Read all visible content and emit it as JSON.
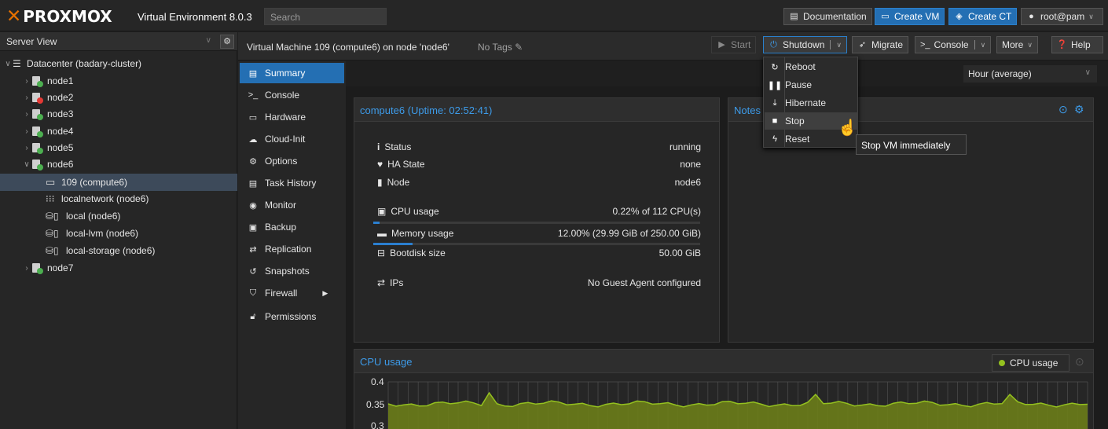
{
  "header": {
    "logo_text": "PROXMOX",
    "product": "Virtual Environment 8.0.3",
    "search_placeholder": "Search",
    "buttons": {
      "documentation": "Documentation",
      "create_vm": "Create VM",
      "create_ct": "Create CT",
      "user": "root@pam"
    }
  },
  "sidebar": {
    "view": "Server View",
    "datacenter": "Datacenter (badary-cluster)",
    "nodes": [
      "node1",
      "node2",
      "node3",
      "node4",
      "node5",
      "node6"
    ],
    "node6_children": [
      "109 (compute6)",
      "localnetwork (node6)",
      "local (node6)",
      "local-lvm (node6)",
      "local-storage (node6)"
    ],
    "last_node": "node7"
  },
  "vm_toolbar": {
    "title": "Virtual Machine 109 (compute6) on node 'node6'",
    "tags": "No Tags",
    "start": "Start",
    "shutdown": "Shutdown",
    "migrate": "Migrate",
    "console": "Console",
    "more": "More",
    "help": "Help"
  },
  "nav": {
    "items": [
      "Summary",
      "Console",
      "Hardware",
      "Cloud-Init",
      "Options",
      "Task History",
      "Monitor",
      "Backup",
      "Replication",
      "Snapshots",
      "Firewall",
      "Permissions"
    ]
  },
  "timeframe": "Hour (average)",
  "status_panel": {
    "title": "compute6 (Uptime: 02:52:41)",
    "rows": [
      {
        "label": "Status",
        "value": "running"
      },
      {
        "label": "HA State",
        "value": "none"
      },
      {
        "label": "Node",
        "value": "node6"
      },
      {
        "label": "CPU usage",
        "value": "0.22% of 112 CPU(s)"
      },
      {
        "label": "Memory usage",
        "value": "12.00% (29.99 GiB of 250.00 GiB)"
      },
      {
        "label": "Bootdisk size",
        "value": "50.00 GiB"
      },
      {
        "label": "IPs",
        "value": "No Guest Agent configured"
      }
    ],
    "cpu_fraction": 0.0022,
    "memory_fraction": 0.12
  },
  "notes_panel": {
    "title": "Notes"
  },
  "dropdown": {
    "items": [
      "Reboot",
      "Pause",
      "Hibernate",
      "Stop",
      "Reset"
    ],
    "tooltip": "Stop VM immediately"
  },
  "cpu_chart": {
    "title": "CPU usage",
    "legend": "CPU usage",
    "ticks": [
      "0.4",
      "0.35",
      "0.3"
    ],
    "color": "#94c11f"
  },
  "colors": {
    "accent": "#246fb3",
    "brand": "#e57000",
    "link": "#3d9be9"
  }
}
